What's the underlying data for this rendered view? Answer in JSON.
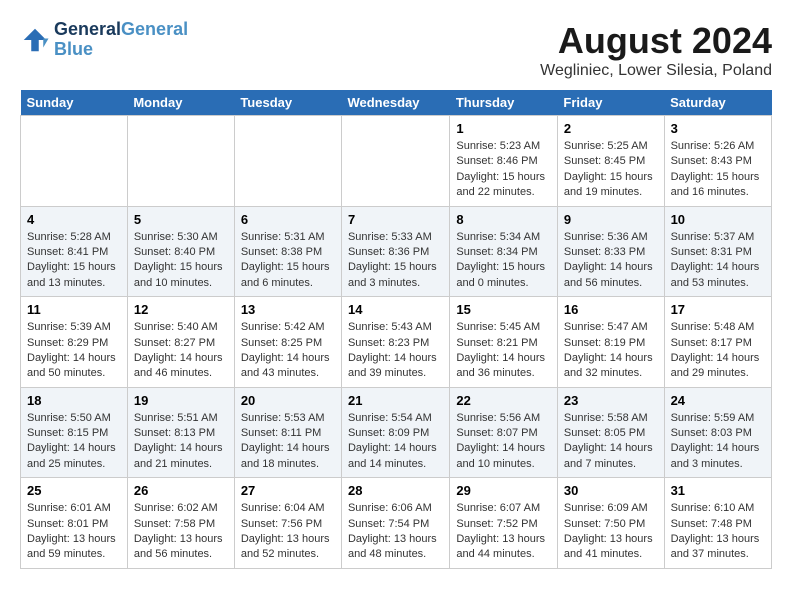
{
  "logo": {
    "line1": "General",
    "line2": "Blue"
  },
  "title": "August 2024",
  "subtitle": "Wegliniec, Lower Silesia, Poland",
  "days_of_week": [
    "Sunday",
    "Monday",
    "Tuesday",
    "Wednesday",
    "Thursday",
    "Friday",
    "Saturday"
  ],
  "weeks": [
    [
      {
        "day": "",
        "info": ""
      },
      {
        "day": "",
        "info": ""
      },
      {
        "day": "",
        "info": ""
      },
      {
        "day": "",
        "info": ""
      },
      {
        "day": "1",
        "info": "Sunrise: 5:23 AM\nSunset: 8:46 PM\nDaylight: 15 hours\nand 22 minutes."
      },
      {
        "day": "2",
        "info": "Sunrise: 5:25 AM\nSunset: 8:45 PM\nDaylight: 15 hours\nand 19 minutes."
      },
      {
        "day": "3",
        "info": "Sunrise: 5:26 AM\nSunset: 8:43 PM\nDaylight: 15 hours\nand 16 minutes."
      }
    ],
    [
      {
        "day": "4",
        "info": "Sunrise: 5:28 AM\nSunset: 8:41 PM\nDaylight: 15 hours\nand 13 minutes."
      },
      {
        "day": "5",
        "info": "Sunrise: 5:30 AM\nSunset: 8:40 PM\nDaylight: 15 hours\nand 10 minutes."
      },
      {
        "day": "6",
        "info": "Sunrise: 5:31 AM\nSunset: 8:38 PM\nDaylight: 15 hours\nand 6 minutes."
      },
      {
        "day": "7",
        "info": "Sunrise: 5:33 AM\nSunset: 8:36 PM\nDaylight: 15 hours\nand 3 minutes."
      },
      {
        "day": "8",
        "info": "Sunrise: 5:34 AM\nSunset: 8:34 PM\nDaylight: 15 hours\nand 0 minutes."
      },
      {
        "day": "9",
        "info": "Sunrise: 5:36 AM\nSunset: 8:33 PM\nDaylight: 14 hours\nand 56 minutes."
      },
      {
        "day": "10",
        "info": "Sunrise: 5:37 AM\nSunset: 8:31 PM\nDaylight: 14 hours\nand 53 minutes."
      }
    ],
    [
      {
        "day": "11",
        "info": "Sunrise: 5:39 AM\nSunset: 8:29 PM\nDaylight: 14 hours\nand 50 minutes."
      },
      {
        "day": "12",
        "info": "Sunrise: 5:40 AM\nSunset: 8:27 PM\nDaylight: 14 hours\nand 46 minutes."
      },
      {
        "day": "13",
        "info": "Sunrise: 5:42 AM\nSunset: 8:25 PM\nDaylight: 14 hours\nand 43 minutes."
      },
      {
        "day": "14",
        "info": "Sunrise: 5:43 AM\nSunset: 8:23 PM\nDaylight: 14 hours\nand 39 minutes."
      },
      {
        "day": "15",
        "info": "Sunrise: 5:45 AM\nSunset: 8:21 PM\nDaylight: 14 hours\nand 36 minutes."
      },
      {
        "day": "16",
        "info": "Sunrise: 5:47 AM\nSunset: 8:19 PM\nDaylight: 14 hours\nand 32 minutes."
      },
      {
        "day": "17",
        "info": "Sunrise: 5:48 AM\nSunset: 8:17 PM\nDaylight: 14 hours\nand 29 minutes."
      }
    ],
    [
      {
        "day": "18",
        "info": "Sunrise: 5:50 AM\nSunset: 8:15 PM\nDaylight: 14 hours\nand 25 minutes."
      },
      {
        "day": "19",
        "info": "Sunrise: 5:51 AM\nSunset: 8:13 PM\nDaylight: 14 hours\nand 21 minutes."
      },
      {
        "day": "20",
        "info": "Sunrise: 5:53 AM\nSunset: 8:11 PM\nDaylight: 14 hours\nand 18 minutes."
      },
      {
        "day": "21",
        "info": "Sunrise: 5:54 AM\nSunset: 8:09 PM\nDaylight: 14 hours\nand 14 minutes."
      },
      {
        "day": "22",
        "info": "Sunrise: 5:56 AM\nSunset: 8:07 PM\nDaylight: 14 hours\nand 10 minutes."
      },
      {
        "day": "23",
        "info": "Sunrise: 5:58 AM\nSunset: 8:05 PM\nDaylight: 14 hours\nand 7 minutes."
      },
      {
        "day": "24",
        "info": "Sunrise: 5:59 AM\nSunset: 8:03 PM\nDaylight: 14 hours\nand 3 minutes."
      }
    ],
    [
      {
        "day": "25",
        "info": "Sunrise: 6:01 AM\nSunset: 8:01 PM\nDaylight: 13 hours\nand 59 minutes."
      },
      {
        "day": "26",
        "info": "Sunrise: 6:02 AM\nSunset: 7:58 PM\nDaylight: 13 hours\nand 56 minutes."
      },
      {
        "day": "27",
        "info": "Sunrise: 6:04 AM\nSunset: 7:56 PM\nDaylight: 13 hours\nand 52 minutes."
      },
      {
        "day": "28",
        "info": "Sunrise: 6:06 AM\nSunset: 7:54 PM\nDaylight: 13 hours\nand 48 minutes."
      },
      {
        "day": "29",
        "info": "Sunrise: 6:07 AM\nSunset: 7:52 PM\nDaylight: 13 hours\nand 44 minutes."
      },
      {
        "day": "30",
        "info": "Sunrise: 6:09 AM\nSunset: 7:50 PM\nDaylight: 13 hours\nand 41 minutes."
      },
      {
        "day": "31",
        "info": "Sunrise: 6:10 AM\nSunset: 7:48 PM\nDaylight: 13 hours\nand 37 minutes."
      }
    ]
  ]
}
